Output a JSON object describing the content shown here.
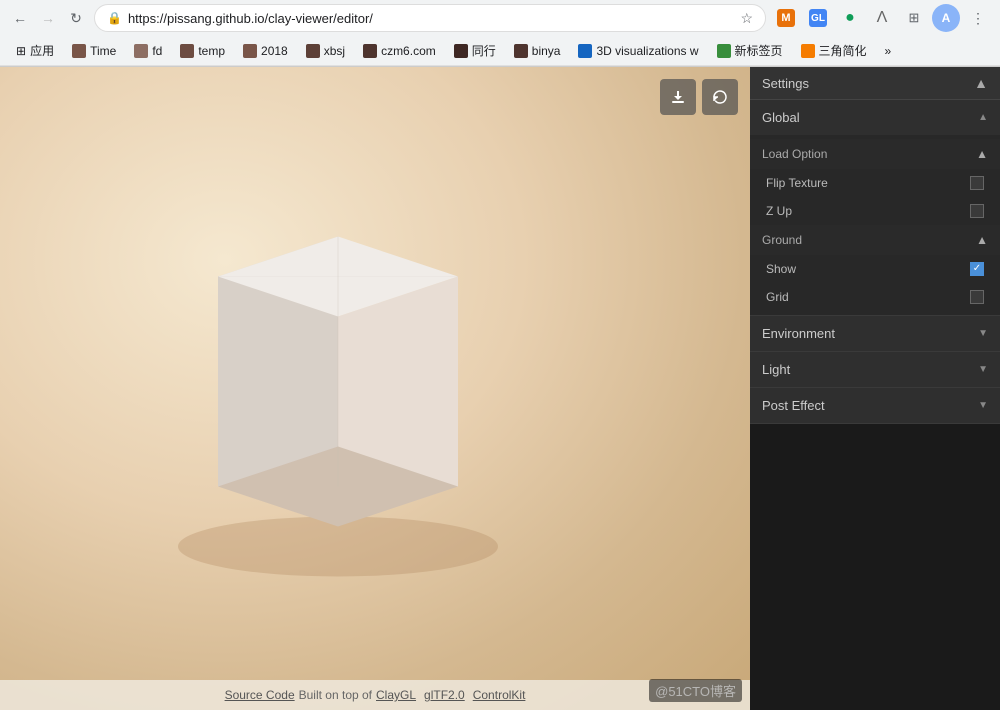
{
  "browser": {
    "url": "https://pissang.github.io/clay-viewer/editor/",
    "back_disabled": false,
    "forward_disabled": true
  },
  "bookmarks": [
    {
      "label": "应用",
      "icon": "grid"
    },
    {
      "label": "Time",
      "color": "#795548"
    },
    {
      "label": "fd",
      "color": "#8d6e63"
    },
    {
      "label": "temp",
      "color": "#6d4c41"
    },
    {
      "label": "2018",
      "color": "#795548"
    },
    {
      "label": "xbsj",
      "color": "#5d4037"
    },
    {
      "label": "czm6.com",
      "color": "#4e342e"
    },
    {
      "label": "同行",
      "color": "#3e2723"
    },
    {
      "label": "binya",
      "color": "#4e342e"
    },
    {
      "label": "3D visualizations w",
      "color": "#1565C0"
    },
    {
      "label": "新标签页",
      "color": "#388E3C"
    },
    {
      "label": "三角简化",
      "color": "#F57C00"
    },
    {
      "label": "»",
      "color": "#555"
    }
  ],
  "viewport": {
    "download_btn": "⬇",
    "reset_btn": "↺"
  },
  "footer": {
    "source_code_label": "Source Code",
    "built_text": "Built on top of",
    "links": [
      "ClayGL",
      "glTF2.0",
      "ControlKit"
    ]
  },
  "settings": {
    "title": "Settings",
    "sections": [
      {
        "id": "global",
        "label": "Global",
        "expanded": true,
        "subsections": [
          {
            "id": "load-option",
            "label": "Load Option",
            "expanded": true,
            "settings": [
              {
                "label": "Flip Texture",
                "type": "checkbox",
                "checked": false
              },
              {
                "label": "Z Up",
                "type": "checkbox",
                "checked": false
              }
            ]
          },
          {
            "id": "ground",
            "label": "Ground",
            "expanded": true,
            "settings": [
              {
                "label": "Show",
                "type": "checkbox",
                "checked": true
              },
              {
                "label": "Grid",
                "type": "checkbox",
                "checked": false
              }
            ]
          }
        ]
      },
      {
        "id": "environment",
        "label": "Environment",
        "expanded": false
      },
      {
        "id": "light",
        "label": "Light",
        "expanded": false
      },
      {
        "id": "post-effect",
        "label": "Post Effect",
        "expanded": false
      }
    ],
    "watermark": "@51CTO博客"
  }
}
